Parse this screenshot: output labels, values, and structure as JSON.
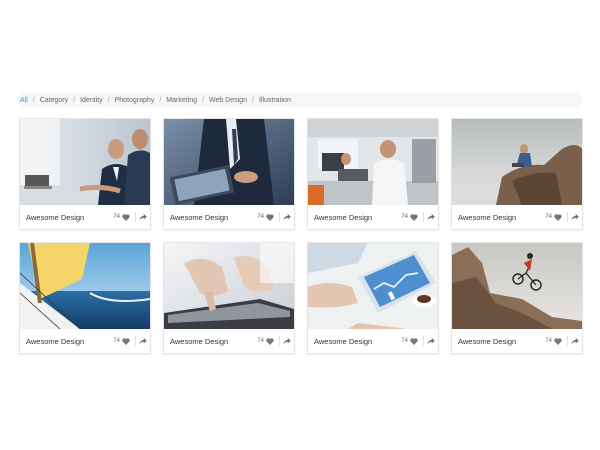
{
  "filters": {
    "items": [
      "All",
      "Category",
      "Identity",
      "Photography",
      "Marketing",
      "Web Design",
      "Illustration"
    ],
    "separator": "/",
    "active": "All",
    "active_color": "#3498db"
  },
  "cards": [
    {
      "title": "Awesome Design",
      "likes": "74",
      "image": "business-meeting-laptop-photo"
    },
    {
      "title": "Awesome Design",
      "likes": "74",
      "image": "businessman-tablet-photo"
    },
    {
      "title": "Awesome Design",
      "likes": "74",
      "image": "office-computer-workers-photo"
    },
    {
      "title": "Awesome Design",
      "likes": "74",
      "image": "man-on-cliff-laptop-photo"
    },
    {
      "title": "Awesome Design",
      "likes": "74",
      "image": "sailboat-ocean-photo"
    },
    {
      "title": "Awesome Design",
      "likes": "74",
      "image": "hand-touching-tablet-photo"
    },
    {
      "title": "Awesome Design",
      "likes": "74",
      "image": "tablet-charts-coffee-photo"
    },
    {
      "title": "Awesome Design",
      "likes": "74",
      "image": "cyclist-on-rocks-photo"
    }
  ],
  "icons": {
    "like": "heart-icon",
    "share": "share-arrow-icon"
  }
}
